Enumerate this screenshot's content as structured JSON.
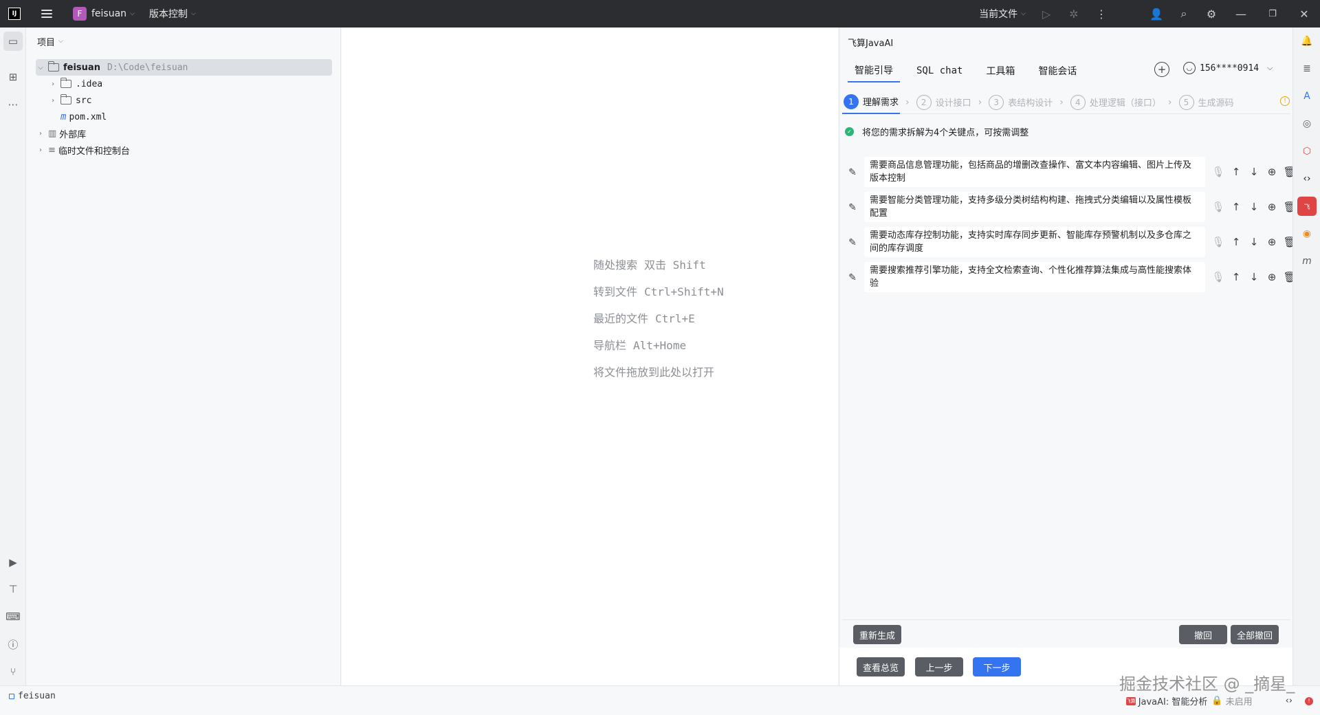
{
  "titlebar": {
    "project_initial": "F",
    "project_name": "feisuan",
    "vcs_label": "版本控制",
    "run_config": "当前文件"
  },
  "project_panel": {
    "header": "项目",
    "tree": {
      "root_name": "feisuan",
      "root_path": "D:\\Code\\feisuan",
      "items": [
        ".idea",
        "src",
        "pom.xml"
      ],
      "external_libs": "外部库",
      "scratches": "临时文件和控制台"
    }
  },
  "editor": {
    "hints": [
      {
        "label": "随处搜索",
        "key": "双击 Shift"
      },
      {
        "label": "转到文件",
        "key": "Ctrl+Shift+N"
      },
      {
        "label": "最近的文件",
        "key": "Ctrl+E"
      },
      {
        "label": "导航栏",
        "key": "Alt+Home"
      },
      {
        "label": "将文件拖放到此处以打开",
        "key": ""
      }
    ]
  },
  "ai_panel": {
    "title": "飞算JavaAI",
    "tabs": [
      "智能引导",
      "SQL chat",
      "工具箱",
      "智能会话"
    ],
    "user": "156****0914",
    "steps": [
      {
        "num": "1",
        "label": "理解需求"
      },
      {
        "num": "2",
        "label": "设计接口"
      },
      {
        "num": "3",
        "label": "表结构设计"
      },
      {
        "num": "4",
        "label": "处理逻辑（接口）"
      },
      {
        "num": "5",
        "label": "生成源码"
      }
    ],
    "summary": "将您的需求拆解为4个关键点，可按需调整",
    "requirements": [
      "需要商品信息管理功能，包括商品的增删改查操作、富文本内容编辑、图片上传及版本控制",
      "需要智能分类管理功能，支持多级分类树结构构建、拖拽式分类编辑以及属性模板配置",
      "需要动态库存控制功能，支持实时库存同步更新、智能库存预警机制以及多仓库之间的库存调度",
      "需要搜索推荐引擎功能，支持全文检索查询、个性化推荐算法集成与高性能搜索体验"
    ],
    "buttons": {
      "regenerate": "重新生成",
      "undo": "撤回",
      "undo_all": "全部撤回",
      "overview": "查看总览",
      "prev": "上一步",
      "next": "下一步"
    }
  },
  "statusbar": {
    "project": "feisuan",
    "plugin_badge": "飞算",
    "plugin_status": "JavaAI: 智能分析",
    "lock_status": "未启用"
  },
  "watermark": "掘金技术社区 @ _摘星_",
  "colors": {
    "titlebar_bg": "#2b2d30",
    "accent": "#3574f0",
    "project_badge": "#b25ab9",
    "success": "#2bb673"
  }
}
